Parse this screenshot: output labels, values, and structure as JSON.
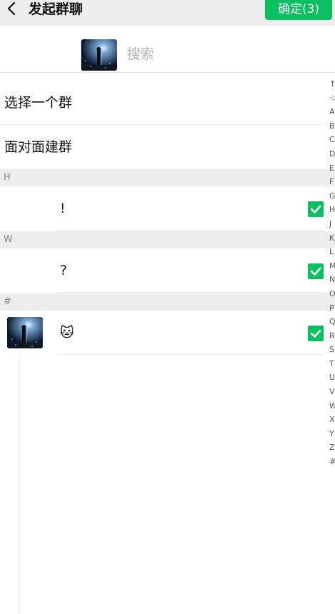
{
  "header": {
    "title": "发起群聊",
    "confirm_label": "确定(3)"
  },
  "search": {
    "placeholder": "搜索"
  },
  "menu": {
    "select_group": "选择一个群",
    "face_to_face": "面对面建群"
  },
  "sections": [
    {
      "letter": "H",
      "contact_name": "!",
      "checked": true
    },
    {
      "letter": "W",
      "contact_name": "?",
      "checked": true
    },
    {
      "letter": "#",
      "contact_name": "🐱",
      "checked": true
    }
  ],
  "index_letters": [
    "↑",
    "☆",
    "A",
    "B",
    "C",
    "D",
    "E",
    "F",
    "G",
    "H",
    "J",
    "K",
    "L",
    "M",
    "N",
    "O",
    "P",
    "Q",
    "R",
    "S",
    "T",
    "U",
    "V",
    "W",
    "X",
    "Y",
    "Z",
    "#"
  ],
  "colors": {
    "accent": "#07c160",
    "header_bg": "#ededed"
  },
  "icons": {
    "back": "back-arrow-icon",
    "check": "check-icon"
  }
}
